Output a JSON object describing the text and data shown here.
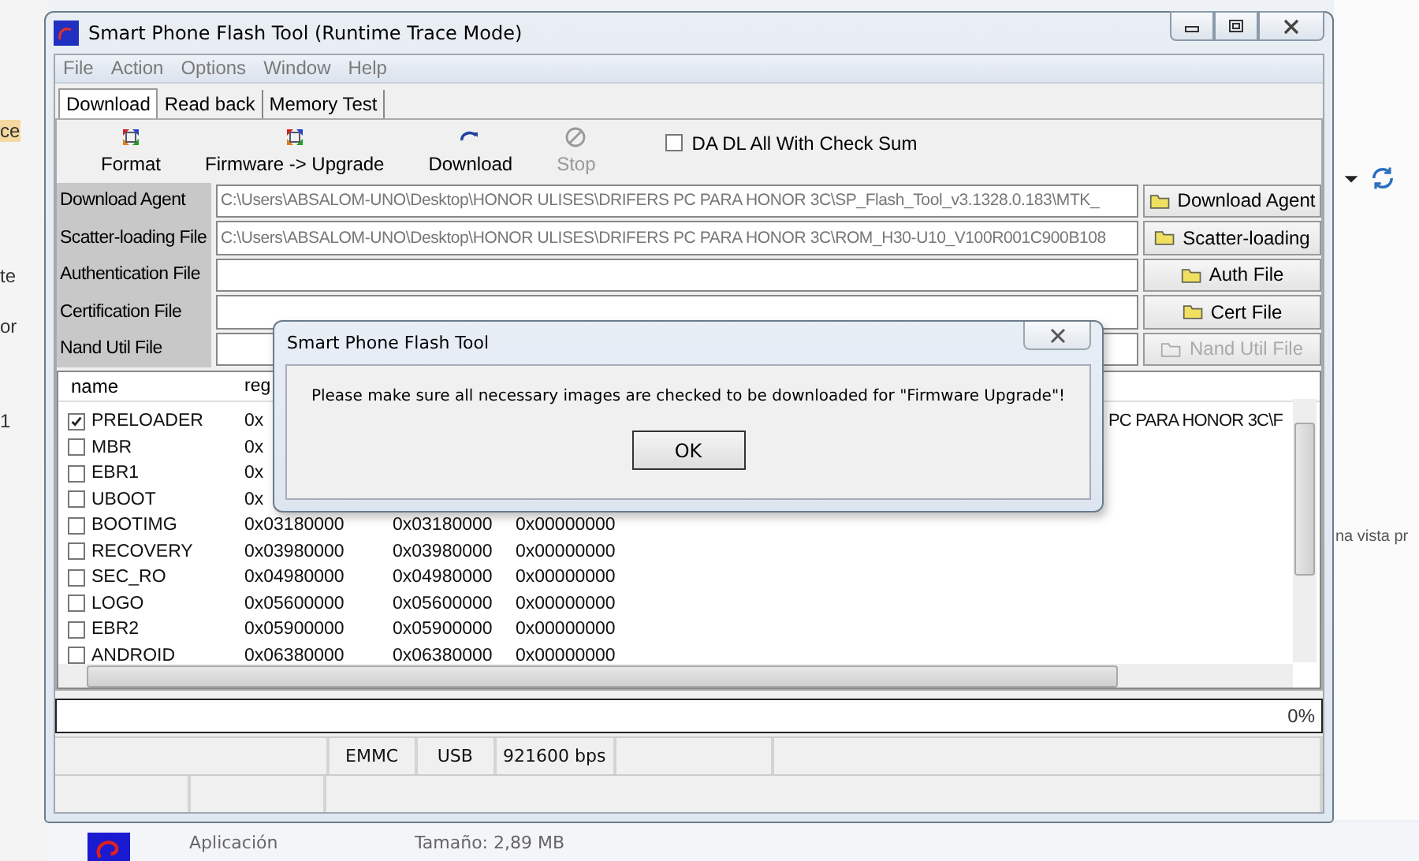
{
  "window": {
    "title": "Smart Phone Flash Tool (Runtime Trace Mode)"
  },
  "menu": [
    "File",
    "Action",
    "Options",
    "Window",
    "Help"
  ],
  "tabs": [
    {
      "label": "Download",
      "selected": true
    },
    {
      "label": "Read back",
      "selected": false
    },
    {
      "label": "Memory Test",
      "selected": false
    }
  ],
  "toolbar": [
    {
      "label": "Format",
      "kind": "format",
      "disabled": false
    },
    {
      "label": "Firmware -> Upgrade",
      "kind": "upgrade",
      "disabled": false
    },
    {
      "label": "Download",
      "kind": "download",
      "disabled": false
    },
    {
      "label": "Stop",
      "kind": "stop",
      "disabled": true
    }
  ],
  "checksum_option": {
    "label": "DA DL All With Check Sum",
    "checked": false
  },
  "file_rows": [
    {
      "label": "Download Agent",
      "value": "C:\\Users\\ABSALOM-UNO\\Desktop\\HONOR ULISES\\DRIFERS PC PARA HONOR 3C\\SP_Flash_Tool_v3.1328.0.183\\MTK_",
      "button": "Download Agent",
      "disabled": false
    },
    {
      "label": "Scatter-loading File",
      "value": "C:\\Users\\ABSALOM-UNO\\Desktop\\HONOR ULISES\\DRIFERS PC PARA HONOR 3C\\ROM_H30-U10_V100R001C900B108",
      "button": "Scatter-loading",
      "disabled": false
    },
    {
      "label": "Authentication File",
      "button": "Auth File",
      "disabled": false
    },
    {
      "label": "Certification File",
      "button": "Cert File",
      "disabled": false
    },
    {
      "label": "Nand Util File",
      "button": "Nand Util File",
      "disabled": true
    }
  ],
  "image_table": {
    "columns": [
      "name",
      "reg"
    ],
    "rows": [
      {
        "checked": true,
        "cells": [
          "PRELOADER",
          "0x",
          "",
          "",
          "",
          "PC PARA HONOR 3C\\F"
        ]
      },
      {
        "checked": false,
        "cells": [
          "MBR",
          "0x"
        ]
      },
      {
        "checked": false,
        "cells": [
          "EBR1",
          "0x"
        ]
      },
      {
        "checked": false,
        "cells": [
          "UBOOT",
          "0x"
        ]
      },
      {
        "checked": false,
        "cells": [
          "BOOTIMG",
          "0x03180000",
          "0x03180000",
          "0x00000000"
        ]
      },
      {
        "checked": false,
        "cells": [
          "RECOVERY",
          "0x03980000",
          "0x03980000",
          "0x00000000"
        ]
      },
      {
        "checked": false,
        "cells": [
          "SEC_RO",
          "0x04980000",
          "0x04980000",
          "0x00000000"
        ]
      },
      {
        "checked": false,
        "cells": [
          "LOGO",
          "0x05600000",
          "0x05600000",
          "0x00000000"
        ]
      },
      {
        "checked": false,
        "cells": [
          "EBR2",
          "0x05900000",
          "0x05900000",
          "0x00000000"
        ]
      },
      {
        "checked": false,
        "cells": [
          "ANDROID",
          "0x06380000",
          "0x06380000",
          "0x00000000"
        ]
      }
    ]
  },
  "progress": {
    "level": 0,
    "label": "0%"
  },
  "status_bar": [
    "EMMC",
    "USB",
    "921600 bps"
  ],
  "dialog": {
    "title": "Smart Phone Flash Tool",
    "message": "Please make sure all necessary images are checked to be downloaded for \"Firmware Upgrade\"!",
    "button": "OK"
  },
  "desktop": {
    "left_fragments": [
      "ce",
      "te",
      "or",
      "1"
    ],
    "preview_text": "na vista pr",
    "file_type": "Aplicación",
    "file_size": "Tamaño: 2,89 MB"
  }
}
